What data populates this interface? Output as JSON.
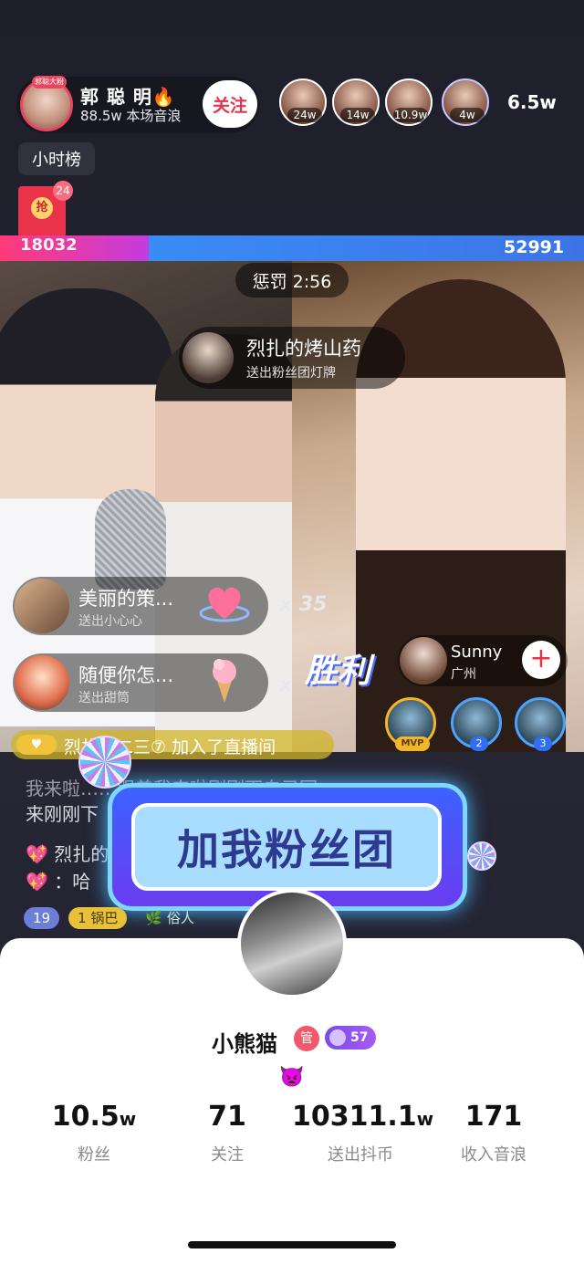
{
  "host": {
    "name": "郭 聪 明🔥",
    "subtitle": "88.5w 本场音浪",
    "tag": "郭聪大粉",
    "follow_label": "关注"
  },
  "viewers": [
    {
      "value": "24w"
    },
    {
      "value": "14w"
    },
    {
      "value": "10.9w"
    },
    {
      "value": "4w"
    }
  ],
  "viewer_total": "6.5w",
  "rank_label": "小时榜",
  "redpack": {
    "label": "抢",
    "count": "24"
  },
  "pk": {
    "left_score": "18032",
    "right_score": "52991",
    "left_share": 0.255
  },
  "penalty": "惩罚 2:56",
  "gift_notice": {
    "name": "烈扎的烤山药",
    "desc": "送出粉丝团灯牌"
  },
  "gifts": [
    {
      "name": "美丽的策...",
      "desc": "送出小心心",
      "combo": "x 35"
    },
    {
      "name": "随便你怎...",
      "desc": "送出甜筒",
      "combo": "x"
    }
  ],
  "victory": "胜利",
  "guest": {
    "name": "Sunny",
    "city": "广州",
    "add": "+"
  },
  "guest_ranks": [
    {
      "badge": "MVP"
    },
    {
      "badge": "2"
    },
    {
      "badge": "3"
    }
  ],
  "join_banner": "烈扎的二三⑦ 加入了直播间",
  "comments": {
    "line1": "我来啦……跟着我来啦刚刚下自己回",
    "line2": "来刚刚下",
    "line3": "💖 烈扎的",
    "line4": "💖 ：哈"
  },
  "fan_banner": "加我粉丝团",
  "badges": [
    {
      "text": "19"
    },
    {
      "text": "1 锅巴"
    },
    {
      "text": "🌿 俗人"
    }
  ],
  "profile": {
    "name": "小熊猫",
    "admin": "管",
    "level": "57",
    "emoji": "👿",
    "stats": [
      {
        "value": "10.5",
        "unit": "w",
        "label": "粉丝"
      },
      {
        "value": "71",
        "unit": "",
        "label": "关注"
      },
      {
        "value": "10311.1",
        "unit": "w",
        "label": "送出抖币"
      },
      {
        "value": "171",
        "unit": "",
        "label": "收入音浪"
      }
    ]
  },
  "colors": {
    "accent": "#e8334a",
    "pk_left": "#ff3b78",
    "pk_right": "#3a8cf5"
  }
}
